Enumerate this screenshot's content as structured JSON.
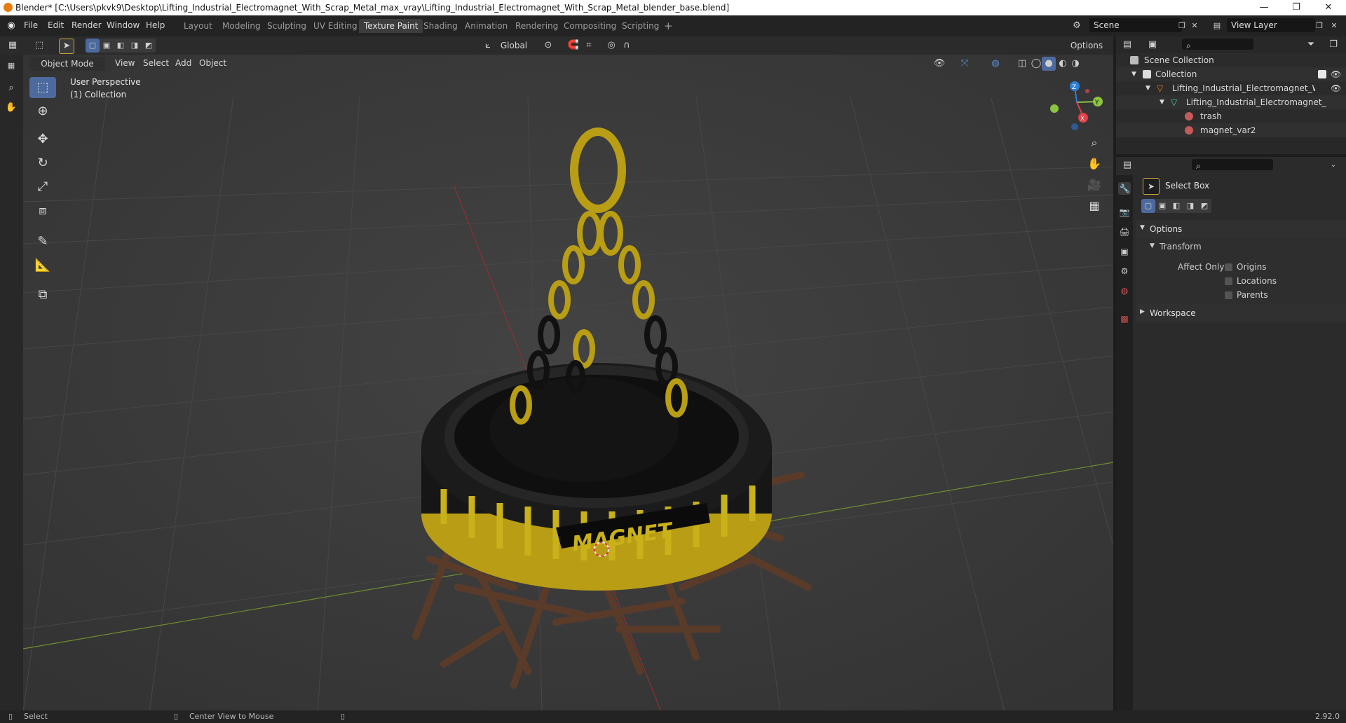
{
  "window": {
    "title": "Blender* [C:\\Users\\pkvk9\\Desktop\\Lifting_Industrial_Electromagnet_With_Scrap_Metal_max_vray\\Lifting_Industrial_Electromagnet_With_Scrap_Metal_blender_base.blend]",
    "minimize": "—",
    "restore": "❐",
    "close": "✕"
  },
  "menu": [
    "File",
    "Edit",
    "Render",
    "Window",
    "Help"
  ],
  "workspaces": [
    "Layout",
    "Modeling",
    "Sculpting",
    "UV Editing",
    "Texture Paint",
    "Shading",
    "Animation",
    "Rendering",
    "Compositing",
    "Scripting"
  ],
  "workspace_add": "+",
  "scene": {
    "label": "Scene",
    "view_layer": "View Layer"
  },
  "tool_header": {
    "orientation": "Global",
    "options": "Options"
  },
  "view_header": {
    "mode": "Object Mode",
    "items": [
      "View",
      "Select",
      "Add",
      "Object"
    ]
  },
  "viewport": {
    "perspective": "User Perspective",
    "collection": "(1) Collection",
    "magnet_label": "MAGNET",
    "axis_x": "X",
    "axis_y": "Y",
    "axis_z": "Z"
  },
  "outliner": {
    "scene_collection": "Scene Collection",
    "collection": "Collection",
    "object": "Lifting_Industrial_Electromagnet_With_S",
    "mesh": "Lifting_Industrial_Electromagnet_Wi",
    "materials": [
      "trash",
      "magnet_var2"
    ]
  },
  "properties": {
    "tool_name": "Select Box",
    "options_header": "Options",
    "transform_header": "Transform",
    "affect_only": "Affect Only",
    "checkboxes": [
      "Origins",
      "Locations",
      "Parents"
    ],
    "workspace_header": "Workspace"
  },
  "status": {
    "select": "Select",
    "center_view": "Center View to Mouse",
    "version": "2.92.0"
  },
  "colors": {
    "accent": "#4d6a9e",
    "x_axis": "#e0404a",
    "y_axis": "#8bc53f",
    "z_axis": "#2f7fd6",
    "magnet_yellow": "#c9b11a"
  }
}
